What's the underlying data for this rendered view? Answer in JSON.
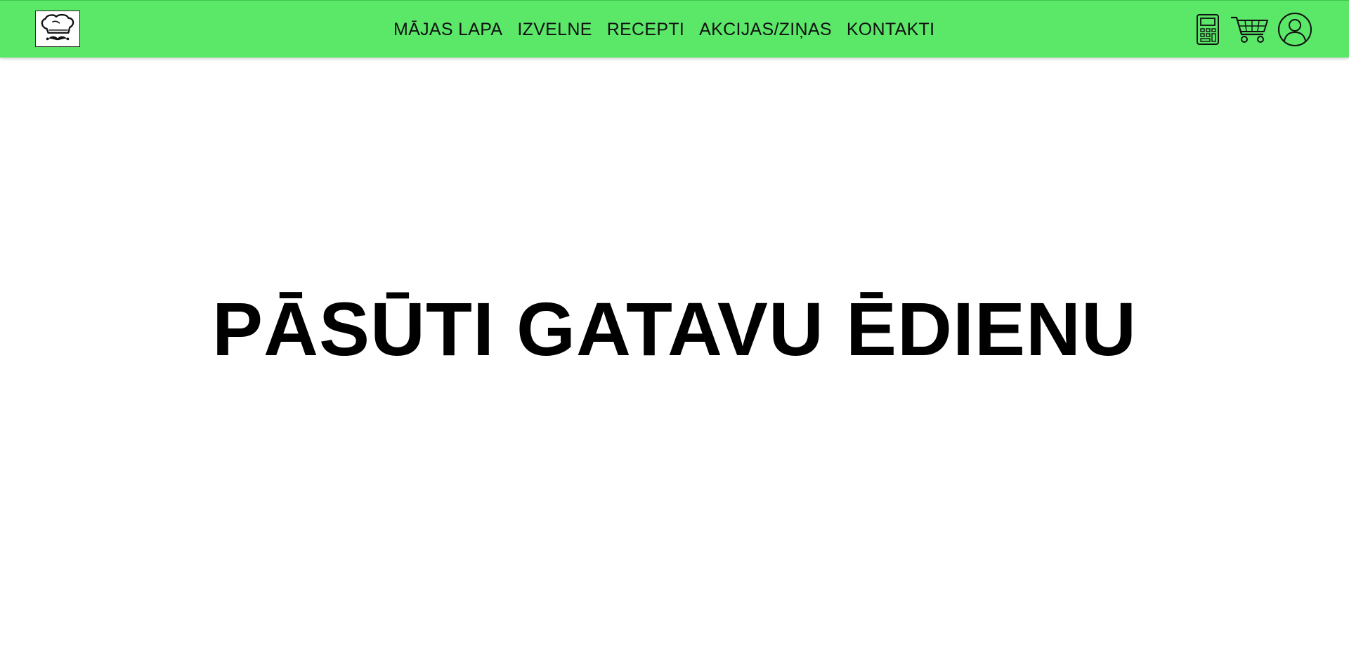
{
  "header": {
    "logo_icon": "chef-hat-mustache-icon",
    "nav": [
      {
        "label": "MĀJAS LAPA"
      },
      {
        "label": "IZVELNE"
      },
      {
        "label": "RECEPTI"
      },
      {
        "label": "AKCIJAS/ZIŅAS"
      },
      {
        "label": "KONTAKTI"
      }
    ],
    "icons": [
      "calculator-icon",
      "shopping-cart-icon",
      "user-account-icon"
    ],
    "background_color": "#5be869"
  },
  "hero": {
    "title": "PĀSŪTI GATAVU ĒDIENU"
  }
}
